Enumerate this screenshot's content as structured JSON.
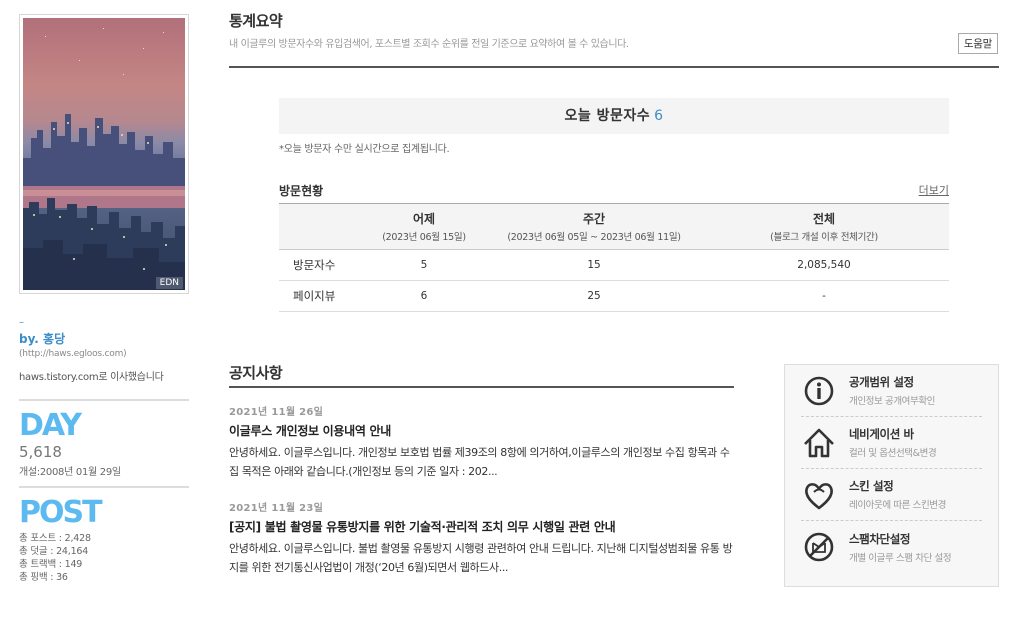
{
  "sidebar": {
    "avatar_tag": "EDN",
    "dash": "–",
    "byline": "by. 홍당",
    "blog_url": "(http://haws.egloos.com)",
    "moved_note": "haws.tistory.com로 이사했습니다",
    "day_label": "DAY",
    "day_count": "5,618",
    "open_date": "개설:2008년 01월 29일",
    "post_label": "POST",
    "stats": [
      "총 포스트 : 2,428",
      "총 덧글 : 24,164",
      "총 트랙백 : 149",
      "총 핑백 : 36"
    ]
  },
  "header": {
    "title": "통계요약",
    "description": "내 이글루의 방문자수와 유입검색어, 포스트별 조회수 순위를 전일 기준으로 요약하여 볼 수 있습니다.",
    "help_label": "도움말"
  },
  "today": {
    "label": "오늘 방문자수",
    "count": "6",
    "note": "*오늘 방문자 수만 실시간으로 집계됩니다."
  },
  "visits": {
    "title": "방문현황",
    "more_label": "더보기",
    "columns": [
      {
        "label": "어제",
        "sub": "(2023년 06월 15일)"
      },
      {
        "label": "주간",
        "sub": "(2023년 06월 05일 ~ 2023년 06월 11일)"
      },
      {
        "label": "전체",
        "sub": "(블로그 개설 이후 전체기간)"
      }
    ],
    "rows": [
      {
        "label": "방문자수",
        "values": [
          "5",
          "15",
          "2,085,540"
        ]
      },
      {
        "label": "페이지뷰",
        "values": [
          "6",
          "25",
          "-"
        ]
      }
    ]
  },
  "notices": {
    "title": "공지사항",
    "items": [
      {
        "date": "2021년 11월 26일",
        "headline": "이글루스 개인정보 이용내역 안내",
        "body": "안녕하세요. 이글루스입니다. 개인정보 보호법 법률 제39조의 8항에 의거하여,이글루스의 개인정보 수집 항목과 수집 목적은 아래와 같습니다.(개인정보 등의 기준 일자 : 202..."
      },
      {
        "date": "2021년 11월 23일",
        "headline": "[공지] 불법 촬영물 유통방지를 위한 기술적·관리적 조치 의무 시행일 관련 안내",
        "body": "안녕하세요. 이글루스입니다. 불법 촬영물 유통방지 시행령 관련하여 안내 드립니다. 지난해 디지털성범죄물 유통 방지를 위한 전기통신사업법이 개정(‘20년 6월)되면서 웹하드사..."
      }
    ]
  },
  "settings": [
    {
      "name": "공개범위 설정",
      "desc": "개인정보 공개여부확인",
      "icon": "info-icon"
    },
    {
      "name": "네비게이션 바",
      "desc": "컬러 및 옵션선택&변경",
      "icon": "house-icon"
    },
    {
      "name": "스킨 설정",
      "desc": "레이아웃에 따른 스킨변경",
      "icon": "heart-icon"
    },
    {
      "name": "스팸차단설정",
      "desc": "개별 이글루 스팸 차단 설정",
      "icon": "no-spam-icon"
    }
  ]
}
